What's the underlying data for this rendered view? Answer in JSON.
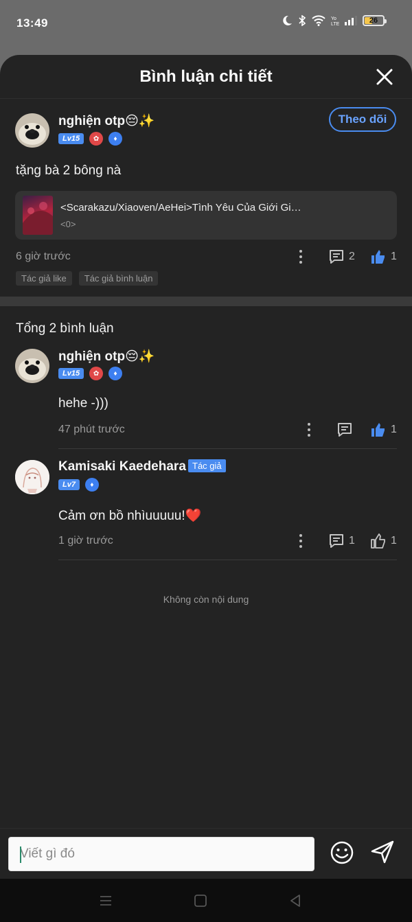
{
  "status": {
    "time": "13:49",
    "battery": "26"
  },
  "header": {
    "title": "Bình luận chi tiết"
  },
  "main_comment": {
    "username": "nghiện otp😔✨",
    "level": "Lv15",
    "follow_label": "Theo dõi",
    "text": "tặng bà 2 bông nà",
    "book": {
      "title": "<Scarakazu/Xiaoven/AeHei>Tình Yêu Của Giới Gi…",
      "subtitle": "<0>"
    },
    "time": "6 giờ trước",
    "reply_count": "2",
    "like_count": "1",
    "tags": [
      "Tác giả like",
      "Tác giả bình luận"
    ]
  },
  "replies_header": "Tổng 2 bình luận",
  "replies": [
    {
      "username": "nghiện otp😔✨",
      "level": "Lv15",
      "text": "hehe -)))",
      "time": "47 phút trước",
      "reply_count": "",
      "like_count": "1"
    },
    {
      "username": "Kamisaki Kaedehara",
      "author_tag": "Tác giả",
      "level": "Lv7",
      "text": "Cảm ơn bồ nhìuuuuu!❤️",
      "time": "1 giờ trước",
      "reply_count": "1",
      "like_count": "1"
    }
  ],
  "end_text": "Không còn nội dung",
  "composer": {
    "placeholder": "Viết gì đó"
  },
  "colors": {
    "accent": "#4a8cf0",
    "background": "#232323",
    "liked": "#4a8cf0"
  }
}
